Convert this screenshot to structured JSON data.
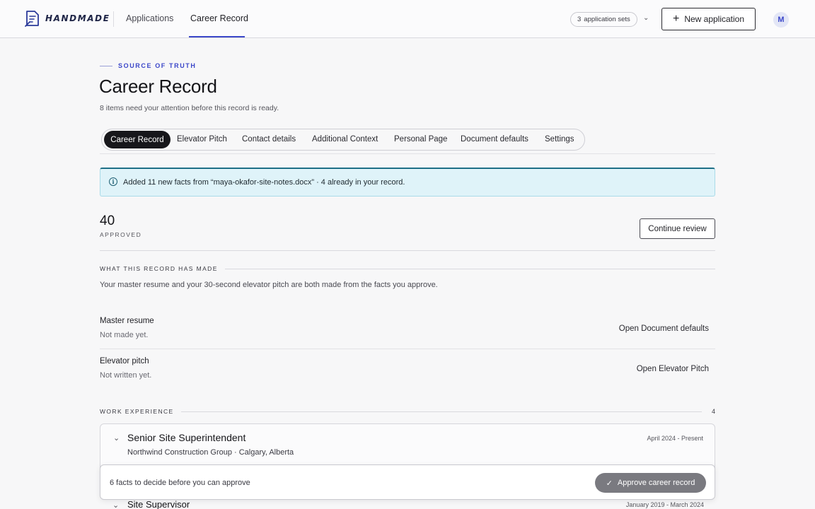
{
  "brand": {
    "name": "HANDMADE",
    "accent": "#3b47c9"
  },
  "nav": {
    "items": [
      "Applications",
      "Career Record"
    ],
    "active": "Career Record"
  },
  "header": {
    "sets_count": "3",
    "sets_label": "application sets",
    "new_application": "New application",
    "avatar_initial": "M"
  },
  "page": {
    "eyebrow": "SOURCE OF TRUTH",
    "title": "Career Record",
    "subtitle": "8 items need your attention before this record is ready."
  },
  "tabs": [
    "Career Record",
    "Elevator Pitch",
    "Contact details",
    "Additional Context",
    "Personal Page",
    "Document defaults",
    "Settings"
  ],
  "banner": {
    "icon": "info-icon",
    "text": "Added 11 new facts from “maya-okafor-site-notes.docx” · 4 already in your record."
  },
  "stats": {
    "approved_count": "40",
    "approved_label": "APPROVED",
    "continue_label": "Continue review"
  },
  "made": {
    "heading": "WHAT THIS RECORD HAS MADE",
    "description": "Your master resume and your 30-second elevator pitch are both made from the facts you approve.",
    "rows": [
      {
        "title": "Master resume",
        "status": "Not made yet.",
        "link": "Open Document defaults"
      },
      {
        "title": "Elevator pitch",
        "status": "Not written yet.",
        "link": "Open Elevator Pitch"
      }
    ]
  },
  "work": {
    "heading": "WORK EXPERIENCE",
    "count": "4",
    "jobs": [
      {
        "title": "Senior Site Superintendent",
        "org": "Northwind Construction Group · Calgary, Alberta",
        "dates": "April 2024 - Present"
      },
      {
        "title": "Site Supervisor",
        "dates": "January 2019 - March 2024"
      }
    ]
  },
  "action_bar": {
    "text": "6 facts to decide before you can approve",
    "approve_label": "Approve career record"
  }
}
